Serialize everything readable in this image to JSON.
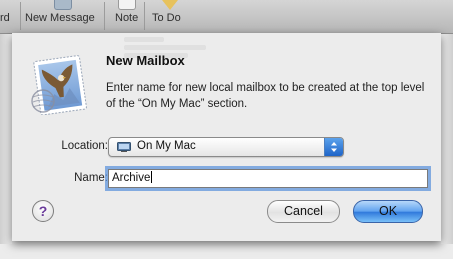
{
  "toolbar": {
    "items": [
      {
        "label": "rd",
        "icon": "forward-icon"
      },
      {
        "label": "New Message",
        "icon": "compose-icon"
      },
      {
        "label": "Note",
        "icon": "note-icon"
      },
      {
        "label": "To Do",
        "icon": "todo-icon"
      }
    ]
  },
  "dialog": {
    "title": "New Mailbox",
    "message": "Enter name for new local mailbox to be created at the top level of the “On My Mac” section.",
    "location_label": "Location:",
    "location_value": "On My Mac",
    "name_label": "Name:",
    "name_value": "Archive",
    "cancel_label": "Cancel",
    "ok_label": "OK",
    "help_label": "?",
    "icon": "mail-stamp-eagle-icon"
  },
  "colors": {
    "default_button": "#3b86e5",
    "focus_ring": "#6096dc",
    "help_glyph": "#6a3a9a"
  }
}
